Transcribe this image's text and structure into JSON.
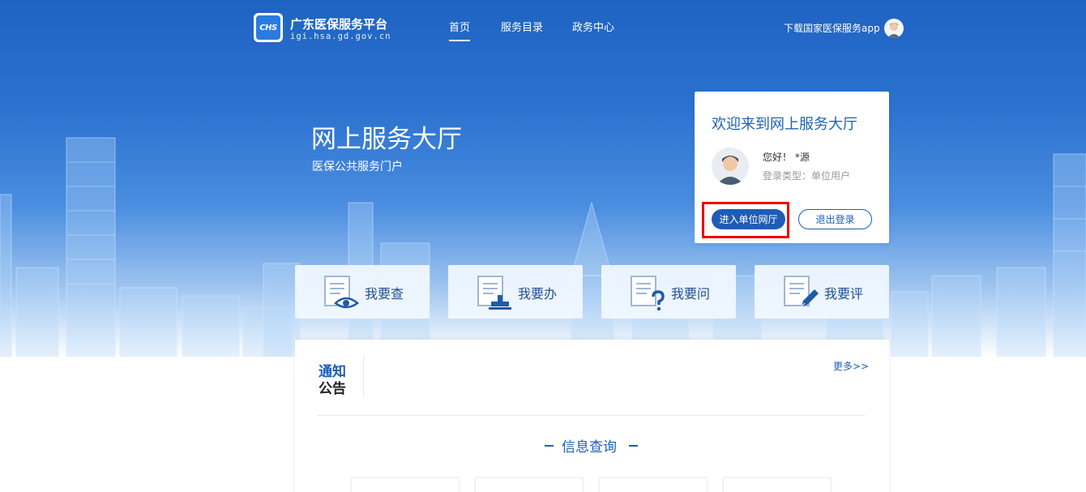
{
  "header": {
    "logo_text": "CHS",
    "site_name": "广东医保服务平台",
    "site_url": "igi.hsa.gd.gov.cn",
    "nav": [
      {
        "label": "首页",
        "active": true
      },
      {
        "label": "服务目录",
        "active": false
      },
      {
        "label": "政务中心",
        "active": false
      }
    ],
    "download_label": "下载国家医保服务app"
  },
  "hero": {
    "title": "网上服务大厅",
    "subtitle": "医保公共服务门户"
  },
  "welcome": {
    "title": "欢迎来到网上服务大厅",
    "greeting": "您好！ *源",
    "login_type": "登录类型：单位用户",
    "enter_button": "进入单位网厅",
    "logout_button": "退出登录"
  },
  "actions": [
    {
      "label": "我要查",
      "icon": "doc-eye-icon"
    },
    {
      "label": "我要办",
      "icon": "doc-stamp-icon"
    },
    {
      "label": "我要问",
      "icon": "doc-question-icon"
    },
    {
      "label": "我要评",
      "icon": "doc-pen-icon"
    }
  ],
  "notice": {
    "title_line1": "通知",
    "title_line2": "公告",
    "more": "更多>>"
  },
  "section": {
    "title": "信息查询"
  },
  "colors": {
    "primary": "#1f5db5",
    "hero_top": "#1f63c2",
    "highlight": "#ee0000"
  }
}
